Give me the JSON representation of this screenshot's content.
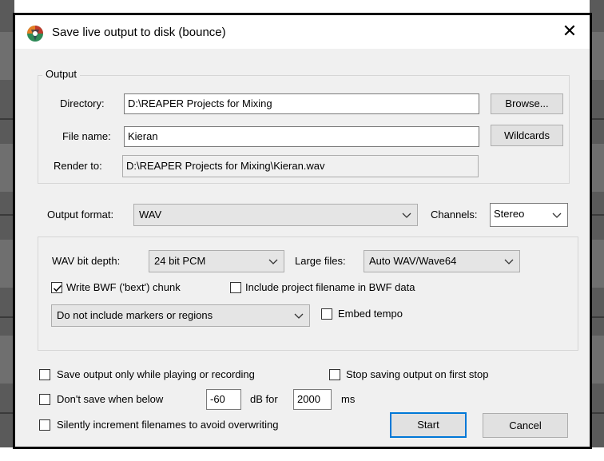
{
  "dialog": {
    "title": "Save live output to disk (bounce)",
    "close_glyph": "✕"
  },
  "output": {
    "group_label": "Output",
    "directory_label": "Directory:",
    "directory_value": "D:\\REAPER Projects for Mixing",
    "browse_label": "Browse...",
    "filename_label": "File name:",
    "filename_value": "Kieran",
    "wildcards_label": "Wildcards",
    "render_to_label": "Render to:",
    "render_to_value": "D:\\REAPER Projects for Mixing\\Kieran.wav"
  },
  "format": {
    "output_format_label": "Output format:",
    "output_format_value": "WAV",
    "channels_label": "Channels:",
    "channels_value": "Stereo"
  },
  "wav": {
    "bit_depth_label": "WAV bit depth:",
    "bit_depth_value": "24 bit PCM",
    "large_files_label": "Large files:",
    "large_files_value": "Auto WAV/Wave64",
    "write_bwf_label": "Write BWF ('bext') chunk",
    "write_bwf_checked": true,
    "include_project_label": "Include project filename in BWF data",
    "include_project_checked": false,
    "markers_value": "Do not include markers or regions",
    "embed_tempo_label": "Embed tempo",
    "embed_tempo_checked": false
  },
  "options": {
    "save_only_playing_label": "Save output only while playing or recording",
    "save_only_playing_checked": false,
    "stop_saving_label": "Stop saving output on first stop",
    "stop_saving_checked": false,
    "dont_save_label": "Don't save when below",
    "dont_save_checked": false,
    "threshold_value": "-60",
    "db_for_label": "dB for",
    "duration_value": "2000",
    "ms_label": "ms",
    "silently_increment_label": "Silently increment filenames to avoid overwriting",
    "silently_increment_checked": false
  },
  "buttons": {
    "start_label": "Start",
    "cancel_label": "Cancel"
  },
  "colors": {
    "accent": "#0078d7",
    "dialog_bg": "#f0f0f0",
    "reaper_logo_red": "#c0392b",
    "reaper_logo_green": "#2e8b57"
  },
  "icons": {
    "app": "reaper-logo-icon",
    "close": "close-icon",
    "dropdown": "chevron-down-icon",
    "checkbox": "checkmark-icon"
  }
}
